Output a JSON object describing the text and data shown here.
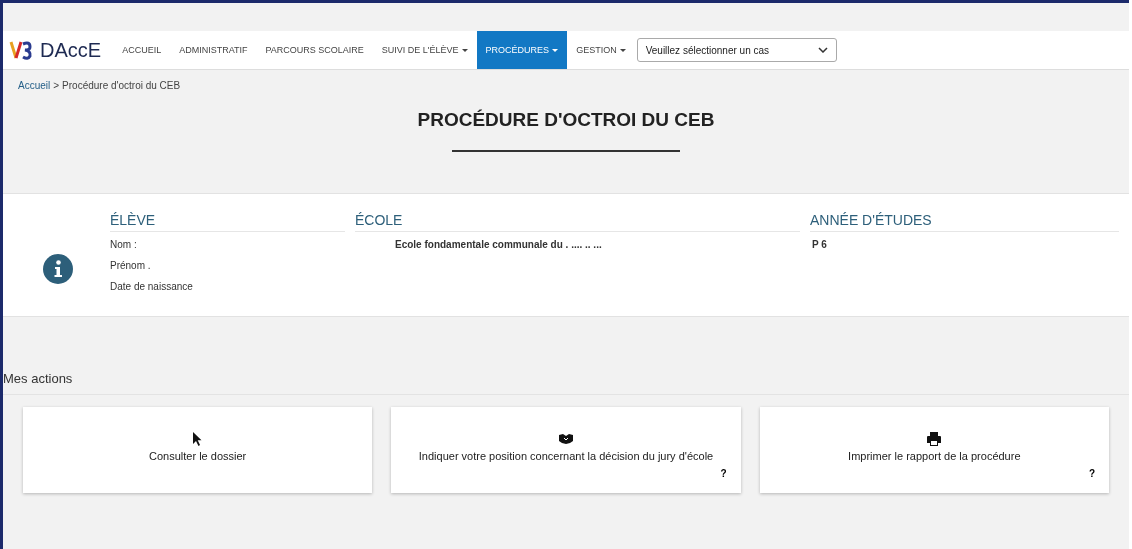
{
  "nav": {
    "logo": "DAccE",
    "items": [
      {
        "label": "ACCUEIL",
        "dropdown": false,
        "selected": false
      },
      {
        "label": "ADMINISTRATIF",
        "dropdown": false,
        "selected": false
      },
      {
        "label": "PARCOURS SCOLAIRE",
        "dropdown": false,
        "selected": false
      },
      {
        "label": "SUIVI DE L'ÉLÈVE",
        "dropdown": true,
        "selected": false
      },
      {
        "label": "PROCÉDURES",
        "dropdown": true,
        "selected": true
      },
      {
        "label": "GESTION",
        "dropdown": true,
        "selected": false
      }
    ],
    "case_select": {
      "value": "Veuillez sélectionner un cas"
    }
  },
  "breadcrumb": {
    "link": "Accueil",
    "separator": ">",
    "current": "Procédure d'octroi du CEB"
  },
  "page_title": "PROCÉDURE D'OCTROI DU CEB",
  "info": {
    "columns": [
      {
        "heading": "ÉLÈVE",
        "lines": [
          "Nom :",
          "Prénom .",
          "Date de naissance"
        ]
      },
      {
        "heading": "ÉCOLE",
        "lines": [
          "Ecole fondamentale communale du . .... .. ..."
        ]
      },
      {
        "heading": "ANNÉE D'ÉTUDES",
        "lines": [
          "P 6"
        ]
      }
    ]
  },
  "actions": {
    "title": "Mes actions",
    "cards": [
      {
        "kind": "pointer",
        "label": "Consulter le dossier"
      },
      {
        "kind": "handshake",
        "label": "Indiquer votre position concernant la décision du jury d'école",
        "help": "?"
      },
      {
        "kind": "printer",
        "label": "Imprimer le rapport de la procédure",
        "help": "?"
      }
    ]
  }
}
